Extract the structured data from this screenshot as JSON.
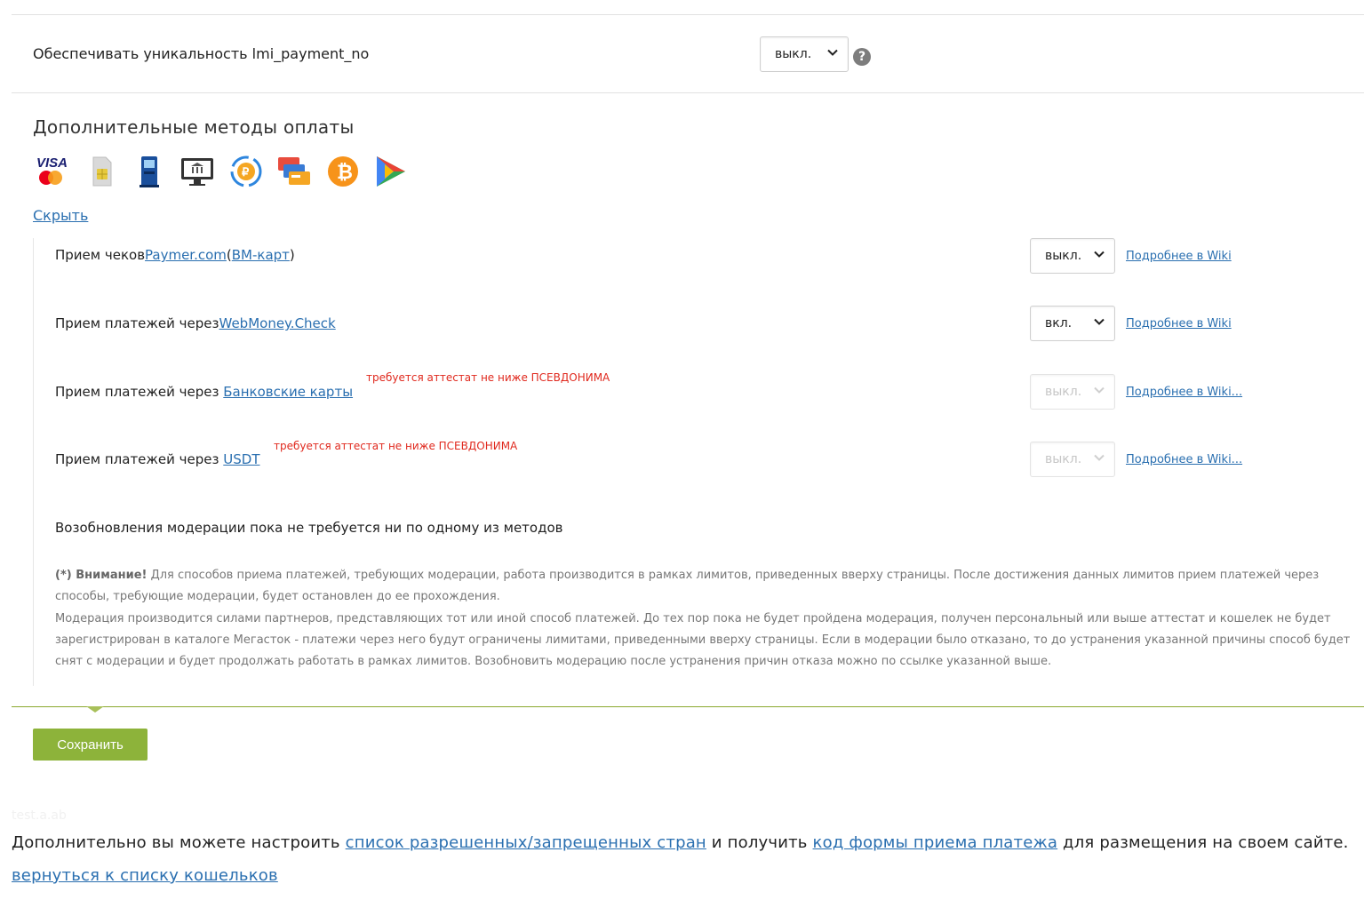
{
  "uniqueness": {
    "label": "Обеспечивать уникальность lmi_payment_no",
    "select_value": "выкл.",
    "help": "?"
  },
  "extra_methods": {
    "title": "Дополнительные методы оплаты",
    "icons": [
      "visa-mastercard-icon",
      "sim-card-icon",
      "payment-terminal-icon",
      "bank-icon",
      "currency-exchange-icon",
      "cards-stack-icon",
      "bitcoin-icon",
      "play-market-icon"
    ],
    "hide_link": "Скрыть"
  },
  "methods": [
    {
      "prefix": "Прием чеков",
      "link1": "Paymer.com",
      "open": "(",
      "link2": "ВМ-карт",
      "close": ")",
      "select_value": "выкл.",
      "wiki": "Подробнее в Wiki"
    },
    {
      "prefix": "Прием платежей через",
      "link1": "WebMoney.Check",
      "select_value": "вкл.",
      "wiki": "Подробнее в Wiki"
    },
    {
      "prefix": "Прием платежей через ",
      "link1": "Банковские карты",
      "warning": "требуется аттестат не ниже ПСЕВДОНИМА",
      "select_value": "выкл.",
      "wiki": "Подробнее в Wiki..."
    },
    {
      "prefix": "Прием платежей через ",
      "link1": "USDT",
      "warning": "требуется аттестат не ниже ПСЕВДОНИМА",
      "select_value": "выкл.",
      "wiki": "Подробнее в Wiki..."
    }
  ],
  "moderation_status": "Возобновления модерации пока не требуется ни по одному из методов",
  "note": {
    "label": "(*) Внимание!",
    "text1": " Для способов приема платежей, требующих модерации, работа производится в рамках лимитов, приведенных вверху страницы. После достижения данных лимитов прием платежей через способы, требующие модерации, будет остановлен до ее прохождения.",
    "text2": "Модерация производится силами партнеров, представляющих тот или иной способ платежей. До тех пор пока не будет пройдена модерация, получен персональный или выше аттестат и кошелек не будет зарегистрирован в каталоге Мегасток - платежи через него будут ограничены лимитами, приведенными вверху страницы. Если в модерации было отказано, то до устранения указанной причины способ будет снят с модерации и будет продолжать работать в рамках лимитов. Возобновить модерацию после устранения причин отказа можно по ссылке указанной выше."
  },
  "save_button": "Сохранить",
  "ghost_text": "test.a.ab",
  "bottom": {
    "t1": "Дополнительно вы можете настроить ",
    "link1": "список разрешенных/запрещенных стран",
    "t2": " и получить ",
    "link2": "код формы приема платежа",
    "t3": " для размещения на своем сайте.",
    "back": "вернуться к списку кошельков"
  },
  "colors": {
    "accent_green": "#8db33a",
    "link_blue": "#2a6fb0",
    "warning_red": "#e0291e"
  }
}
